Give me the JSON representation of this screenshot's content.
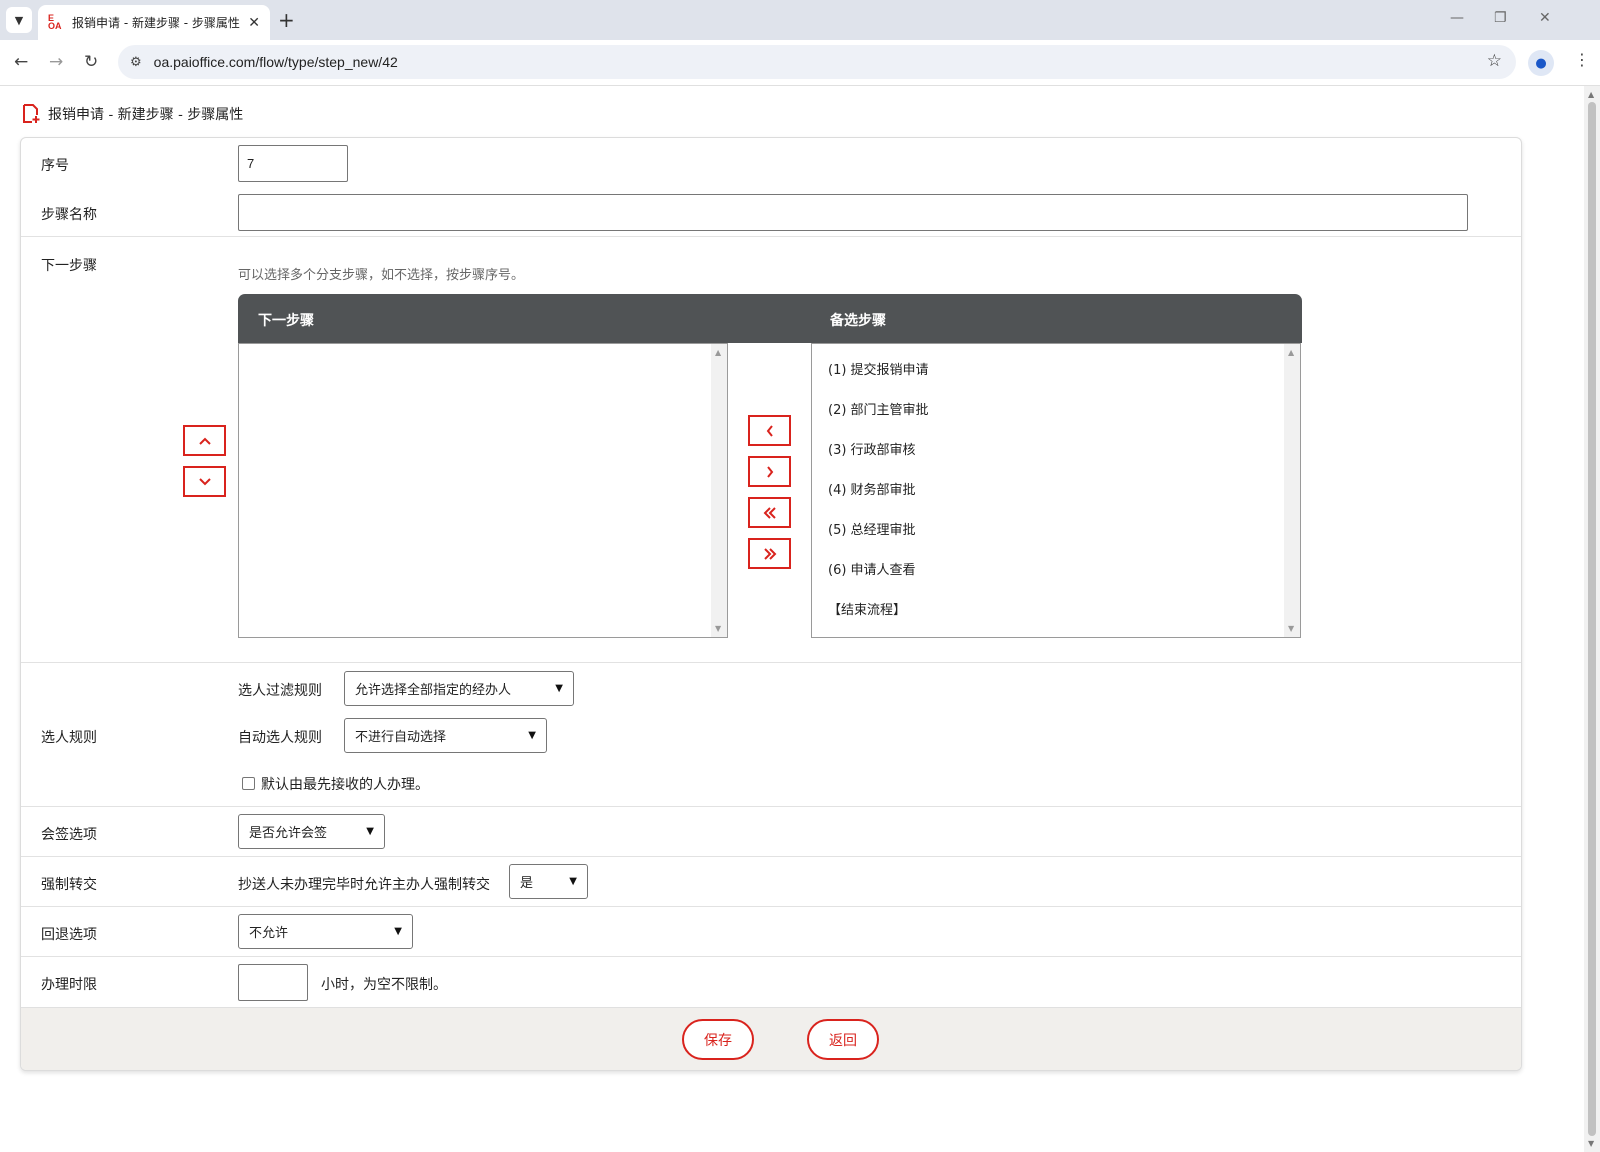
{
  "browser": {
    "tab_title": "报销申请 - 新建步骤 - 步骤属性",
    "url": "oa.paioffice.com/flow/type/step_new/42",
    "favicon_top": "E",
    "favicon_bottom": "OA"
  },
  "page": {
    "title": "报销申请 - 新建步骤 - 步骤属性",
    "accent_color": "#d9231d",
    "header_color": "#505355"
  },
  "form": {
    "sequence": {
      "label": "序号",
      "value": "7"
    },
    "step_name": {
      "label": "步骤名称",
      "value": ""
    },
    "next_step": {
      "label": "下一步骤",
      "hint": "可以选择多个分支步骤，如不选择，按步骤序号。",
      "selected_header": "下一步骤",
      "available_header": "备选步骤",
      "selected_items": [],
      "available_items": [
        "(1) 提交报销申请",
        "(2) 部门主管审批",
        "(3) 行政部审核",
        "(4) 财务部审批",
        "(5) 总经理审批",
        "(6) 申请人查看",
        "【结束流程】"
      ],
      "move_up_icon": "chevron-up-icon",
      "move_down_icon": "chevron-down-icon",
      "add_icon": "chevron-left-icon",
      "remove_icon": "chevron-right-icon",
      "add_all_icon": "double-chevron-left-icon",
      "remove_all_icon": "double-chevron-right-icon"
    },
    "selection_rules": {
      "label": "选人规则",
      "filter_label": "选人过滤规则",
      "filter_value": "允许选择全部指定的经办人",
      "auto_label": "自动选人规则",
      "auto_value": "不进行自动选择",
      "first_receiver_label": "默认由最先接收的人办理。",
      "first_receiver_checked": false
    },
    "countersign": {
      "label": "会签选项",
      "value": "是否允许会签"
    },
    "force_transfer": {
      "label": "强制转交",
      "description": "抄送人未办理完毕时允许主办人强制转交",
      "value": "是"
    },
    "rollback": {
      "label": "回退选项",
      "value": "不允许"
    },
    "time_limit": {
      "label": "办理时限",
      "value": "",
      "suffix": "小时，为空不限制。"
    }
  },
  "actions": {
    "save": "保存",
    "back": "返回"
  }
}
